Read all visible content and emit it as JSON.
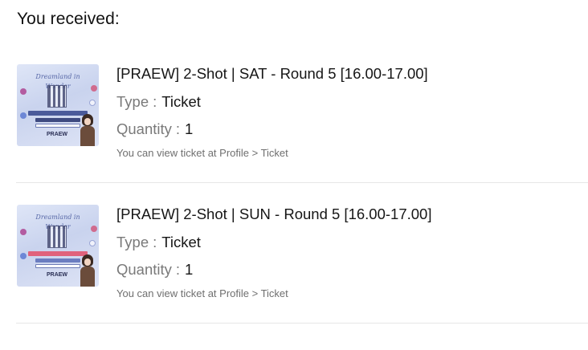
{
  "heading": "You received:",
  "items": [
    {
      "title": "[PRAEW] 2-Shot | SAT - Round 5 [16.00-17.00]",
      "type_label": "Type",
      "separator": ":",
      "type_value": "Ticket",
      "quantity_label": "Quantity",
      "quantity_value": "1",
      "note": "You can view ticket at Profile > Ticket",
      "thumbnail": {
        "brand": "PRAEW",
        "script": "Dreamland in Wonder"
      }
    },
    {
      "title": "[PRAEW] 2-Shot | SUN - Round 5 [16.00-17.00]",
      "type_label": "Type",
      "separator": ":",
      "type_value": "Ticket",
      "quantity_label": "Quantity",
      "quantity_value": "1",
      "note": "You can view ticket at Profile > Ticket",
      "thumbnail": {
        "brand": "PRAEW",
        "script": "Dreamland in Wonder"
      }
    }
  ]
}
